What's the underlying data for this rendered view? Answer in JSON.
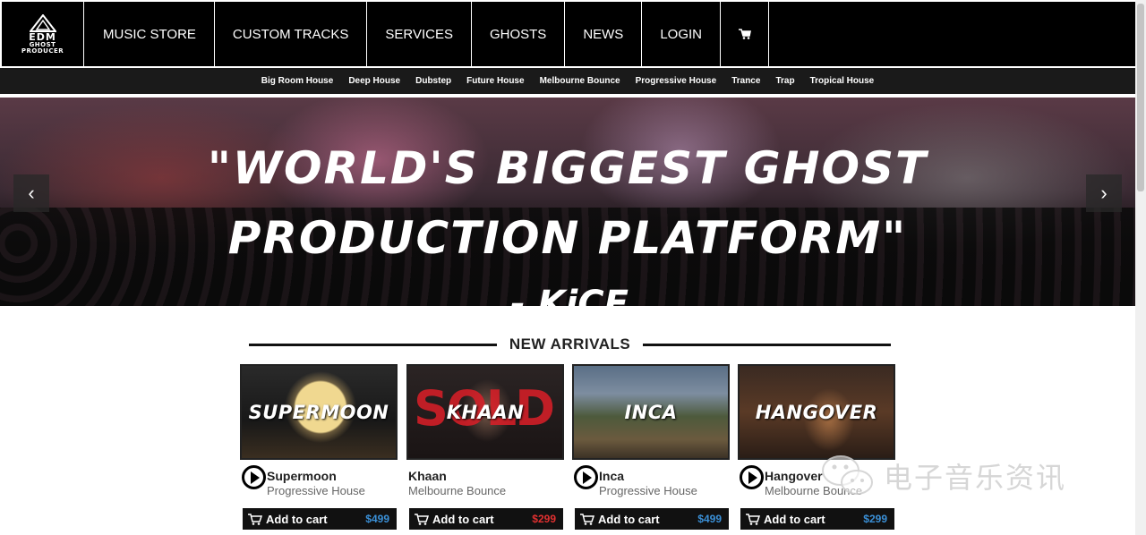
{
  "brand": {
    "logo_line1": "EDM",
    "logo_line2": "GHOST",
    "logo_line3": "PRODUCER"
  },
  "nav": {
    "items": [
      "MUSIC STORE",
      "CUSTOM TRACKS",
      "SERVICES",
      "GHOSTS",
      "NEWS",
      "LOGIN"
    ],
    "cart_icon": "cart-icon"
  },
  "genres": [
    "Big Room House",
    "Deep House",
    "Dubstep",
    "Future House",
    "Melbourne Bounce",
    "Progressive House",
    "Trance",
    "Trap",
    "Tropical House"
  ],
  "hero": {
    "quote_line1": "\"World's Biggest Ghost",
    "quote_line2": "Production Platform\"",
    "credit": "- KiCE",
    "prev_icon": "chevron-left-icon",
    "next_icon": "chevron-right-icon"
  },
  "section": {
    "title": "NEW ARRIVALS"
  },
  "products": [
    {
      "thumb_title": "SUPERMOON",
      "name": "Supermoon",
      "genre": "Progressive House",
      "add_label": "Add to cart",
      "price": "$499",
      "price_color": "#3a8fd6",
      "sold": ""
    },
    {
      "thumb_title": "KHAAN",
      "name": "Khaan",
      "genre": "Melbourne Bounce",
      "add_label": "Add to cart",
      "price": "$299",
      "price_color": "#e03030",
      "sold": "SOLD"
    },
    {
      "thumb_title": "INCA",
      "name": "Inca",
      "genre": "Progressive House",
      "add_label": "Add to cart",
      "price": "$499",
      "price_color": "#3a8fd6",
      "sold": ""
    },
    {
      "thumb_title": "HANGOVER",
      "name": "Hangover",
      "genre": "Melbourne Bounce",
      "add_label": "Add to cart",
      "price": "$299",
      "price_color": "#3a8fd6",
      "sold": ""
    }
  ],
  "watermark": {
    "text": "电子音乐资讯"
  },
  "colors": {
    "nav_bg": "#000000",
    "genre_bg": "#1a1a1a",
    "price_blue": "#3a8fd6",
    "price_red": "#e03030"
  }
}
